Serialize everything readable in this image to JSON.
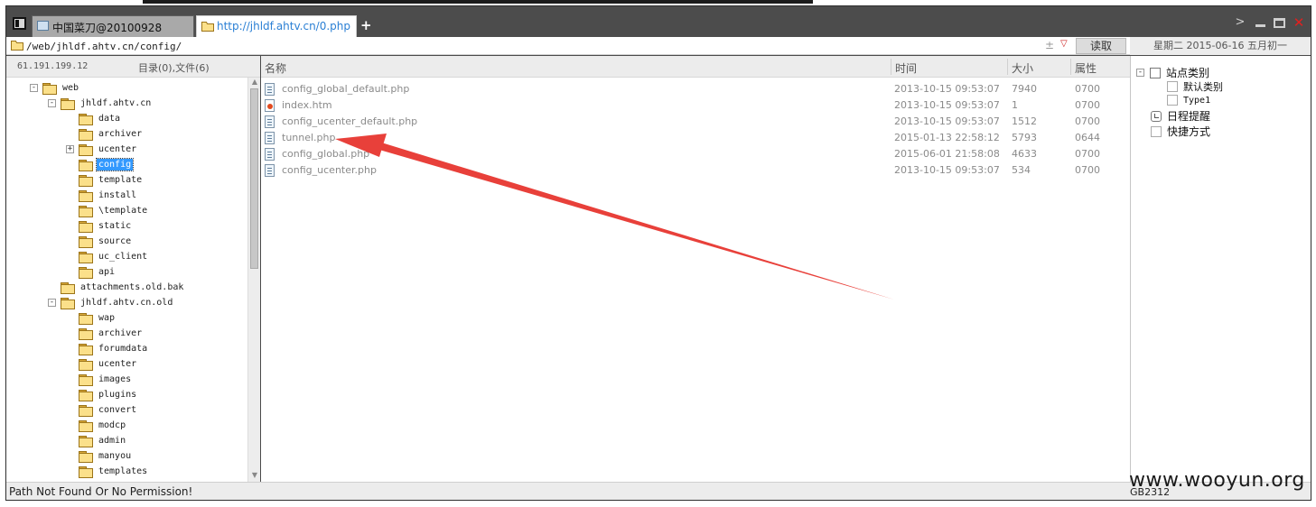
{
  "tabs": [
    {
      "label": "中国菜刀@20100928",
      "active": false
    },
    {
      "label": "http://jhldf.ahtv.cn/0.php",
      "active": true
    }
  ],
  "new_tab_label": "+",
  "address": {
    "value": "/web/jhldf.ahtv.cn/config/",
    "plus": "±",
    "dropdown": "▽"
  },
  "read_button": "读取",
  "date_display": "星期二 2015-06-16 五月初一",
  "left_panel": {
    "ip": "61.191.199.12",
    "counts": "目录(0),文件(6)",
    "tree": [
      {
        "label": "web",
        "level": 0,
        "expander": "-"
      },
      {
        "label": "jhldf.ahtv.cn",
        "level": 1,
        "expander": "-"
      },
      {
        "label": "data",
        "level": 2,
        "expander": ""
      },
      {
        "label": "archiver",
        "level": 2,
        "expander": ""
      },
      {
        "label": "ucenter",
        "level": 2,
        "expander": "+"
      },
      {
        "label": "config",
        "level": 2,
        "expander": "",
        "selected": true
      },
      {
        "label": "template",
        "level": 2,
        "expander": ""
      },
      {
        "label": "install",
        "level": 2,
        "expander": ""
      },
      {
        "label": "\\template",
        "level": 2,
        "expander": ""
      },
      {
        "label": "static",
        "level": 2,
        "expander": ""
      },
      {
        "label": "source",
        "level": 2,
        "expander": ""
      },
      {
        "label": "uc_client",
        "level": 2,
        "expander": ""
      },
      {
        "label": "api",
        "level": 2,
        "expander": ""
      },
      {
        "label": "attachments.old.bak",
        "level": 1,
        "expander": ""
      },
      {
        "label": "jhldf.ahtv.cn.old",
        "level": 1,
        "expander": "-"
      },
      {
        "label": "wap",
        "level": 2,
        "expander": ""
      },
      {
        "label": "archiver",
        "level": 2,
        "expander": ""
      },
      {
        "label": "forumdata",
        "level": 2,
        "expander": ""
      },
      {
        "label": "ucenter",
        "level": 2,
        "expander": ""
      },
      {
        "label": "images",
        "level": 2,
        "expander": ""
      },
      {
        "label": "plugins",
        "level": 2,
        "expander": ""
      },
      {
        "label": "convert",
        "level": 2,
        "expander": ""
      },
      {
        "label": "modcp",
        "level": 2,
        "expander": ""
      },
      {
        "label": "admin",
        "level": 2,
        "expander": ""
      },
      {
        "label": "manyou",
        "level": 2,
        "expander": ""
      },
      {
        "label": "templates",
        "level": 2,
        "expander": ""
      }
    ]
  },
  "file_list": {
    "columns": {
      "name": "名称",
      "time": "时间",
      "size": "大小",
      "attr": "属性"
    },
    "rows": [
      {
        "name": "config_global_default.php",
        "time": "2013-10-15 09:53:07",
        "size": "7940",
        "attr": "0700",
        "icon": "php-file-icon"
      },
      {
        "name": "index.htm",
        "time": "2013-10-15 09:53:07",
        "size": "1",
        "attr": "0700",
        "icon": "html-file-icon"
      },
      {
        "name": "config_ucenter_default.php",
        "time": "2013-10-15 09:53:07",
        "size": "1512",
        "attr": "0700",
        "icon": "php-file-icon"
      },
      {
        "name": "tunnel.php",
        "time": "2015-01-13 22:58:12",
        "size": "5793",
        "attr": "0644",
        "icon": "php-file-icon"
      },
      {
        "name": "config_global.php",
        "time": "2015-06-01 21:58:08",
        "size": "4633",
        "attr": "0700",
        "icon": "php-file-icon"
      },
      {
        "name": "config_ucenter.php",
        "time": "2013-10-15 09:53:07",
        "size": "534",
        "attr": "0700",
        "icon": "php-file-icon"
      }
    ]
  },
  "right_panel": {
    "items": [
      {
        "label": "站点类别",
        "expander": "-"
      },
      {
        "label": "默认类别"
      },
      {
        "label": "Type1"
      },
      {
        "label": "日程提醒"
      },
      {
        "label": "快捷方式"
      }
    ]
  },
  "status": {
    "message": "Path Not Found Or No Permission!",
    "encoding": "GB2312"
  },
  "watermark": "www.wooyun.org",
  "colors": {
    "annotation_arrow": "#e8403a",
    "selection": "#3399ff",
    "link_tab": "#2a7fd4"
  }
}
